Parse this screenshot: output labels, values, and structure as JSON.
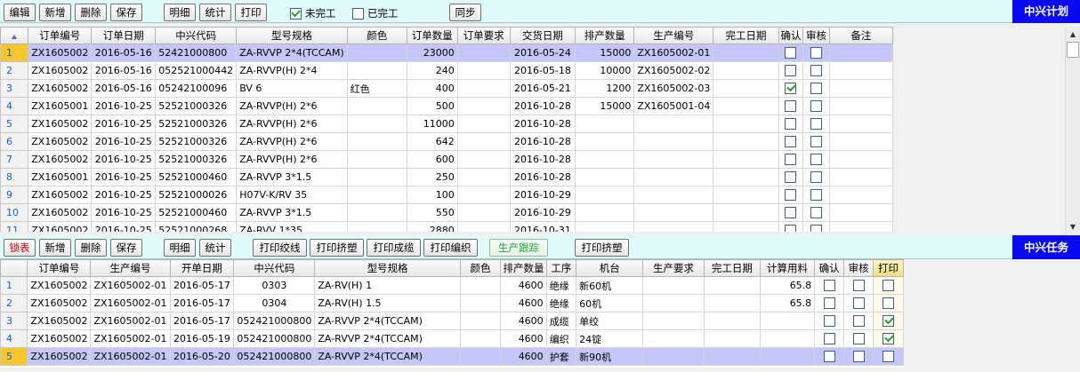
{
  "top_toolbar": {
    "buttons": [
      "编辑",
      "新增",
      "删除",
      "保存",
      "明细",
      "统计",
      "打印",
      "同步"
    ],
    "unfinished_label": "未完工",
    "unfinished_checked": true,
    "finished_label": "已完工",
    "finished_checked": false,
    "panel_title": "中兴计划"
  },
  "plan_grid": {
    "columns": [
      "订单编号",
      "订单日期",
      "中兴代码",
      "型号规格",
      "颜色",
      "订单数量",
      "订单要求",
      "交货日期",
      "排产数量",
      "生产编号",
      "完工日期",
      "确认",
      "审核",
      "备注"
    ],
    "rows": [
      {
        "n": "1",
        "order": "ZX1605002",
        "odate": "2016-05-16",
        "code": "52421000800",
        "spec": "ZA-RVVP 2*4(TCCAM)",
        "color": "",
        "qty": "23000",
        "req": "",
        "ddate": "2016-05-24",
        "sqty": "15000",
        "pno": "ZX1605002-01",
        "fdate": "",
        "confirm": false,
        "audit": false,
        "note": ""
      },
      {
        "n": "2",
        "order": "ZX1605002",
        "odate": "2016-05-16",
        "code": "052521000442",
        "spec": "ZA-RVVP(H) 2*4",
        "color": "",
        "qty": "240",
        "req": "",
        "ddate": "2016-05-18",
        "sqty": "10000",
        "pno": "ZX1605002-02",
        "fdate": "",
        "confirm": false,
        "audit": false,
        "note": ""
      },
      {
        "n": "3",
        "order": "ZX1605002",
        "odate": "2016-05-16",
        "code": "05242100096",
        "spec": "BV 6",
        "color": "红色",
        "qty": "400",
        "req": "",
        "ddate": "2016-05-21",
        "sqty": "1200",
        "pno": "ZX1605002-03",
        "fdate": "",
        "confirm": true,
        "audit": false,
        "note": ""
      },
      {
        "n": "4",
        "order": "ZX1605001",
        "odate": "2016-10-25",
        "code": "52521000326",
        "spec": "ZA-RVVP(H) 2*6",
        "color": "",
        "qty": "500",
        "req": "",
        "ddate": "2016-10-28",
        "sqty": "15000",
        "pno": "ZX1605001-04",
        "fdate": "",
        "confirm": false,
        "audit": false,
        "note": ""
      },
      {
        "n": "5",
        "order": "ZX1605002",
        "odate": "2016-10-25",
        "code": "52521000326",
        "spec": "ZA-RVVP(H) 2*6",
        "color": "",
        "qty": "11000",
        "req": "",
        "ddate": "2016-10-28",
        "sqty": "",
        "pno": "",
        "fdate": "",
        "confirm": false,
        "audit": false,
        "note": ""
      },
      {
        "n": "6",
        "order": "ZX1605002",
        "odate": "2016-10-25",
        "code": "52521000326",
        "spec": "ZA-RVVP(H) 2*6",
        "color": "",
        "qty": "642",
        "req": "",
        "ddate": "2016-10-28",
        "sqty": "",
        "pno": "",
        "fdate": "",
        "confirm": false,
        "audit": false,
        "note": ""
      },
      {
        "n": "7",
        "order": "ZX1605002",
        "odate": "2016-10-25",
        "code": "52521000326",
        "spec": "ZA-RVVP(H) 2*6",
        "color": "",
        "qty": "600",
        "req": "",
        "ddate": "2016-10-28",
        "sqty": "",
        "pno": "",
        "fdate": "",
        "confirm": false,
        "audit": false,
        "note": ""
      },
      {
        "n": "8",
        "order": "ZX1605001",
        "odate": "2016-10-25",
        "code": "52521000460",
        "spec": "ZA-RVVP 3*1.5",
        "color": "",
        "qty": "250",
        "req": "",
        "ddate": "2016-10-28",
        "sqty": "",
        "pno": "",
        "fdate": "",
        "confirm": false,
        "audit": false,
        "note": ""
      },
      {
        "n": "9",
        "order": "ZX1605002",
        "odate": "2016-10-25",
        "code": "52521000026",
        "spec": "H07V-K/RV 35",
        "color": "",
        "qty": "100",
        "req": "",
        "ddate": "2016-10-29",
        "sqty": "",
        "pno": "",
        "fdate": "",
        "confirm": false,
        "audit": false,
        "note": ""
      },
      {
        "n": "10",
        "order": "ZX1605002",
        "odate": "2016-10-25",
        "code": "52521000460",
        "spec": "ZA-RVVP 3*1.5",
        "color": "",
        "qty": "550",
        "req": "",
        "ddate": "2016-10-29",
        "sqty": "",
        "pno": "",
        "fdate": "",
        "confirm": false,
        "audit": false,
        "note": ""
      },
      {
        "n": "11",
        "order": "ZX1605002",
        "odate": "2016-10-25",
        "code": "52521000268",
        "spec": "ZA-RVV 1*35",
        "color": "",
        "qty": "2880",
        "req": "",
        "ddate": "2016-10-31",
        "sqty": "",
        "pno": "",
        "fdate": "",
        "confirm": false,
        "audit": false,
        "note": ""
      }
    ]
  },
  "bottom_toolbar": {
    "buttons": [
      "锁表",
      "新增",
      "删除",
      "保存",
      "明细",
      "统计",
      "打印绞线",
      "打印挤塑",
      "打印成缆",
      "打印编织",
      "生产跟踪",
      "打印挤塑"
    ],
    "panel_title": "中兴任务"
  },
  "task_grid": {
    "columns": [
      "订单编号",
      "生产编号",
      "开单日期",
      "中兴代码",
      "型号规格",
      "颜色",
      "排产数量",
      "工序",
      "机台",
      "生产要求",
      "完工日期",
      "计算用料",
      "确认",
      "审核",
      "打印"
    ],
    "rows": [
      {
        "n": "1",
        "order": "ZX1605002",
        "pno": "ZX1605002-01",
        "odate": "2016-05-17",
        "code": "0303",
        "spec": "ZA-RV(H) 1",
        "color": "",
        "qty": "4600",
        "proc": "绝缘",
        "machine": "新60机",
        "req": "",
        "fdate": "",
        "material": "65.8",
        "confirm": false,
        "audit": false,
        "print": false
      },
      {
        "n": "2",
        "order": "ZX1605002",
        "pno": "ZX1605002-01",
        "odate": "2016-05-17",
        "code": "0304",
        "spec": "ZA-RV(H) 1.5",
        "color": "",
        "qty": "4600",
        "proc": "绝缘",
        "machine": "60机",
        "req": "",
        "fdate": "",
        "material": "65.8",
        "confirm": false,
        "audit": false,
        "print": false
      },
      {
        "n": "3",
        "order": "ZX1605002",
        "pno": "ZX1605002-01",
        "odate": "2016-05-17",
        "code": "052421000800",
        "spec": "ZA-RVVP 2*4(TCCAM)",
        "color": "",
        "qty": "4600",
        "proc": "成缆",
        "machine": "单绞",
        "req": "",
        "fdate": "",
        "material": "",
        "confirm": false,
        "audit": false,
        "print": true
      },
      {
        "n": "4",
        "order": "ZX1605002",
        "pno": "ZX1605002-01",
        "odate": "2016-05-19",
        "code": "052421000800",
        "spec": "ZA-RVVP 2*4(TCCAM)",
        "color": "",
        "qty": "4600",
        "proc": "编织",
        "machine": "24锭",
        "req": "",
        "fdate": "",
        "material": "",
        "confirm": false,
        "audit": false,
        "print": true
      },
      {
        "n": "5",
        "order": "ZX1605002",
        "pno": "ZX1605002-01",
        "odate": "2016-05-20",
        "code": "052421000800",
        "spec": "ZA-RVVP 2*4(TCCAM)",
        "color": "",
        "qty": "4600",
        "proc": "护套",
        "machine": "新90机",
        "req": "",
        "fdate": "",
        "material": "",
        "confirm": false,
        "audit": false,
        "print": false
      }
    ]
  },
  "colors": {
    "title_bg": "#0a0af0",
    "toolbar_bg": "#e0fafa",
    "selected_row": "#c6c6f8",
    "row_indicator": "#f7c52e"
  }
}
